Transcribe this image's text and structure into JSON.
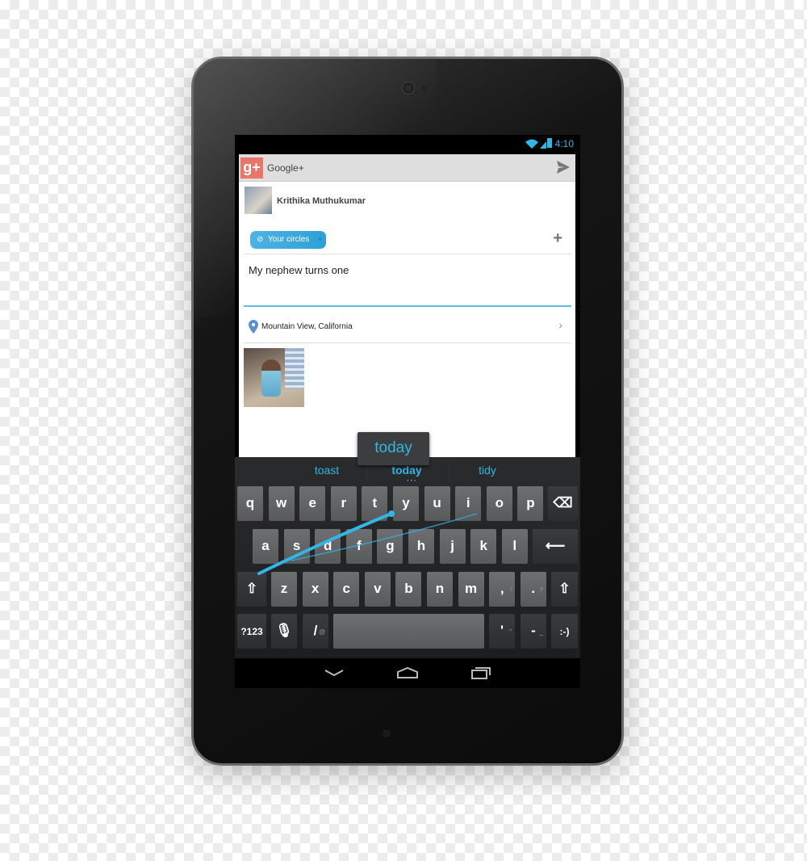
{
  "status_bar": {
    "time": "4:10",
    "icons": [
      "wifi-icon",
      "signal-icon",
      "battery-icon"
    ]
  },
  "app_bar": {
    "title": "Google+",
    "logo": "g+",
    "send_icon": "send-icon"
  },
  "post": {
    "author": "Krithika Muthukumar",
    "audience_chip": "Your circles",
    "text": "My nephew turns one",
    "location": "Mountain View, California"
  },
  "keyboard": {
    "popup": "today",
    "suggestions": [
      "toast",
      "today",
      "tidy"
    ],
    "row1": [
      "q",
      "w",
      "e",
      "r",
      "t",
      "y",
      "u",
      "i",
      "o",
      "p"
    ],
    "row2": [
      "a",
      "s",
      "d",
      "f",
      "g",
      "h",
      "j",
      "k",
      "l"
    ],
    "row3": [
      "z",
      "x",
      "c",
      "v",
      "b",
      "n",
      "m",
      ",",
      "."
    ],
    "row3_hints": [
      "!",
      "?"
    ],
    "row4": {
      "symbols": "?123",
      "slash": "/",
      "slash_hint": "@",
      "apostrophe": "'",
      "apostrophe_hint": "\"",
      "dash": "-",
      "dash_hint": "_",
      "emoticon": ":-)"
    },
    "accent": "#33b5e5"
  },
  "nav": [
    "back-icon",
    "home-icon",
    "recents-icon"
  ]
}
